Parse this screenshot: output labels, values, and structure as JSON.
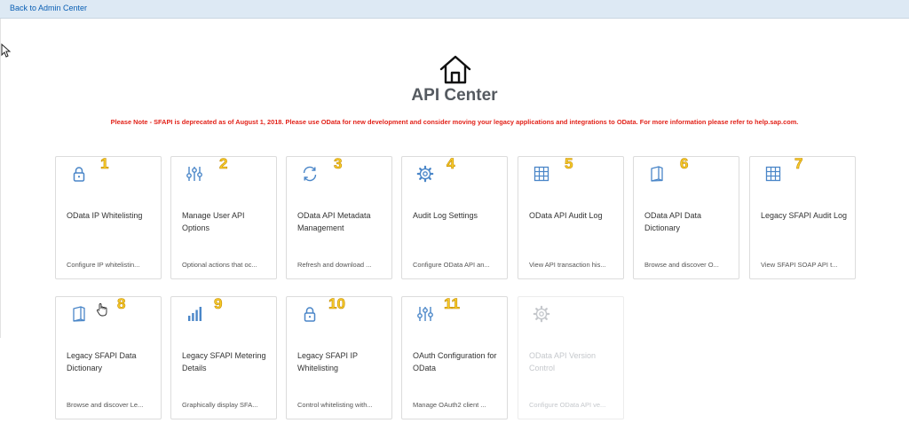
{
  "nav": {
    "back_label": "Back to Admin Center"
  },
  "header": {
    "title": "API Center",
    "notice": "Please Note - SFAPI is deprecated as of August 1, 2018. Please use OData for new development and consider moving your legacy applications and integrations to OData. For more information please refer to help.sap.com."
  },
  "colors": {
    "accent": "#4a86c8",
    "notice": "#e2231a",
    "marker": "#f7cc2a",
    "disabled": "#c5c8cc"
  },
  "tiles": [
    {
      "number": "1",
      "icon": "lock-icon",
      "title": "OData IP Whitelisting",
      "subtitle": "Configure IP whitelistin..."
    },
    {
      "number": "2",
      "icon": "sliders-icon",
      "title": "Manage User API Options",
      "subtitle": "Optional actions that oc..."
    },
    {
      "number": "3",
      "icon": "refresh-icon",
      "title": "OData API Metadata Management",
      "subtitle": "Refresh and download ..."
    },
    {
      "number": "4",
      "icon": "gear-icon",
      "title": "Audit Log Settings",
      "subtitle": "Configure OData API an..."
    },
    {
      "number": "5",
      "icon": "grid-icon",
      "title": "OData API Audit Log",
      "subtitle": "View API transaction his..."
    },
    {
      "number": "6",
      "icon": "book-icon",
      "title": "OData API Data Dictionary",
      "subtitle": "Browse and discover O..."
    },
    {
      "number": "7",
      "icon": "grid-icon",
      "title": "Legacy SFAPI Audit Log",
      "subtitle": "View SFAPI SOAP API t..."
    },
    {
      "number": "8",
      "icon": "book-icon",
      "title": "Legacy SFAPI Data Dictionary",
      "subtitle": "Browse and discover Le..."
    },
    {
      "number": "9",
      "icon": "bar-chart-icon",
      "title": "Legacy SFAPI Metering Details",
      "subtitle": "Graphically display SFA..."
    },
    {
      "number": "10",
      "icon": "lock-icon",
      "title": "Legacy SFAPI IP Whitelisting",
      "subtitle": "Control whitelisting with..."
    },
    {
      "number": "11",
      "icon": "sliders-icon",
      "title": "OAuth Configuration for OData",
      "subtitle": "Manage OAuth2 client ..."
    },
    {
      "number": "",
      "icon": "gear-icon",
      "title": "OData API Version Control",
      "subtitle": "Configure OData API ve...",
      "disabled": true
    }
  ]
}
